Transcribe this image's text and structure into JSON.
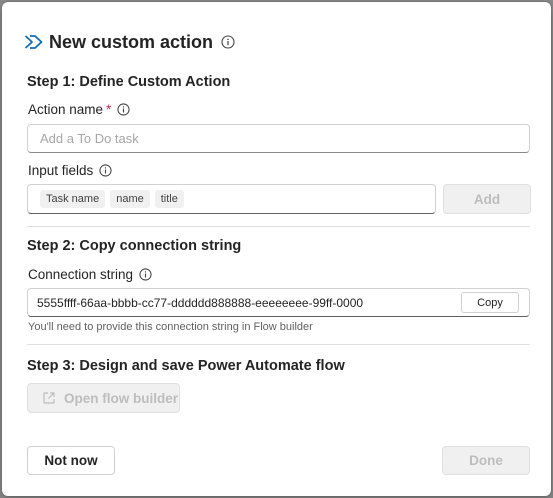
{
  "dialog": {
    "title": "New custom action"
  },
  "step1": {
    "heading": "Step 1: Define Custom Action",
    "action_name_label": "Action name",
    "required_mark": "*",
    "action_name_placeholder": "Add a To Do task",
    "action_name_value": "",
    "input_fields_label": "Input fields",
    "chips": [
      "Task name",
      "name",
      "title"
    ],
    "add_label": "Add"
  },
  "step2": {
    "heading": "Step 2: Copy connection string",
    "connection_label": "Connection string",
    "connection_value": "5555ffff-66aa-bbbb-cc77-dddddd888888-eeeeeeee-99ff-0000",
    "copy_label": "Copy",
    "helper_text": "You'll need to provide this connection string in Flow builder"
  },
  "step3": {
    "heading": "Step 3: Design and save Power Automate flow",
    "open_flow_label": "Open flow builder"
  },
  "footer": {
    "not_now_label": "Not now",
    "done_label": "Done"
  },
  "icons": {
    "title": "power-automate-chevrons-icon",
    "info": "info-icon",
    "open_flow": "open-external-icon"
  },
  "colors": {
    "accent_blue": "#0f6cbd",
    "required_red": "#c4314b",
    "disabled_text": "#bdbdbd",
    "disabled_bg": "#f0f0f0"
  }
}
